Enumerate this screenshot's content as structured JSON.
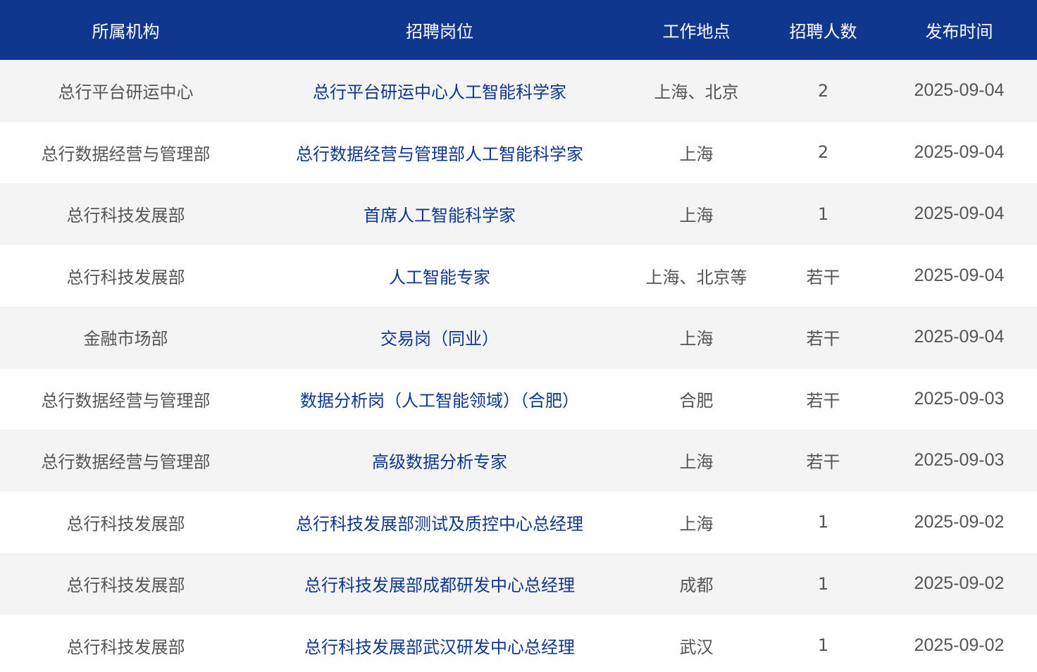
{
  "header": {
    "org": "所属机构",
    "position": "招聘岗位",
    "location": "工作地点",
    "count": "招聘人数",
    "date": "发布时间"
  },
  "rows": [
    {
      "org": "总行平台研运中心",
      "position": "总行平台研运中心人工智能科学家",
      "location": "上海、北京",
      "count": "2",
      "date": "2025-09-04"
    },
    {
      "org": "总行数据经营与管理部",
      "position": "总行数据经营与管理部人工智能科学家",
      "location": "上海",
      "count": "2",
      "date": "2025-09-04"
    },
    {
      "org": "总行科技发展部",
      "position": "首席人工智能科学家",
      "location": "上海",
      "count": "1",
      "date": "2025-09-04"
    },
    {
      "org": "总行科技发展部",
      "position": "人工智能专家",
      "location": "上海、北京等",
      "count": "若干",
      "date": "2025-09-04"
    },
    {
      "org": "金融市场部",
      "position": "交易岗（同业）",
      "location": "上海",
      "count": "若干",
      "date": "2025-09-04"
    },
    {
      "org": "总行数据经营与管理部",
      "position": "数据分析岗（人工智能领域）（合肥）",
      "location": "合肥",
      "count": "若干",
      "date": "2025-09-03"
    },
    {
      "org": "总行数据经营与管理部",
      "position": "高级数据分析专家",
      "location": "上海",
      "count": "若干",
      "date": "2025-09-03"
    },
    {
      "org": "总行科技发展部",
      "position": "总行科技发展部测试及质控中心总经理",
      "location": "上海",
      "count": "1",
      "date": "2025-09-02"
    },
    {
      "org": "总行科技发展部",
      "position": "总行科技发展部成都研发中心总经理",
      "location": "成都",
      "count": "1",
      "date": "2025-09-02"
    },
    {
      "org": "总行科技发展部",
      "position": "总行科技发展部武汉研发中心总经理",
      "location": "武汉",
      "count": "1",
      "date": "2025-09-02"
    }
  ],
  "colors": {
    "header_bg": "#0f378d",
    "link": "#0f378d",
    "text": "#555555",
    "row_alt": "#f4f4f4"
  }
}
